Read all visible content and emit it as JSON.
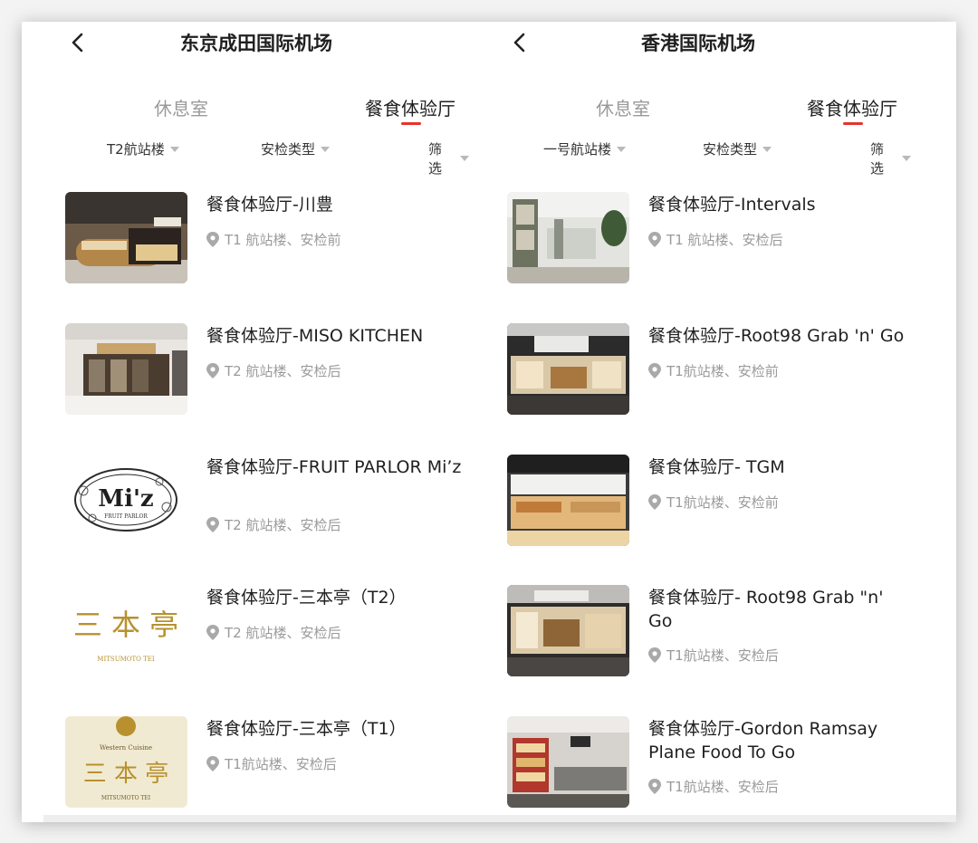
{
  "left": {
    "title": "东京成田国际机场",
    "tabs": [
      {
        "label": "休息室",
        "active": false
      },
      {
        "label": "餐食体验厅",
        "active": true
      }
    ],
    "filters": [
      {
        "label": "T2航站楼"
      },
      {
        "label": "安检类型"
      },
      {
        "label": "筛选"
      }
    ],
    "items": [
      {
        "title": "餐食体验厅-川豊",
        "location": "T1 航站楼、安检前",
        "thumb": "restaurant-counter-photo"
      },
      {
        "title": "餐食体验厅-MISO KITCHEN",
        "location": "T2 航站楼、安检后",
        "thumb": "restaurant-storefront-photo"
      },
      {
        "title": "餐食体验厅-FRUIT PARLOR Mi’z",
        "location": "T2 航站楼、安检后",
        "thumb": "miz-logo",
        "logo_text": "Mi'z",
        "logo_sub": "FRUIT PARLOR"
      },
      {
        "title": "餐食体验厅-三本亭（T2）",
        "location": "T2 航站楼、安检后",
        "thumb": "mitsumoto-logo",
        "logo_text": "三 本 亭",
        "logo_sub": "MITSUMOTO TEI"
      },
      {
        "title": "餐食体验厅-三本亭（T1）",
        "location": "T1航站楼、安检后",
        "thumb": "mitsumoto-logo-beige",
        "logo_text": "三 本 亭",
        "logo_top": "Western Cuisine",
        "logo_sub": "MITSUMOTO TEI"
      }
    ]
  },
  "right": {
    "title": "香港国际机场",
    "tabs": [
      {
        "label": "休息室",
        "active": false
      },
      {
        "label": "餐食体验厅",
        "active": true
      }
    ],
    "filters": [
      {
        "label": "一号航站楼"
      },
      {
        "label": "安检类型"
      },
      {
        "label": "筛选"
      }
    ],
    "items": [
      {
        "title": "餐食体验厅-Intervals",
        "location": "T1 航站楼、安检后",
        "thumb": "lounge-interior-photo"
      },
      {
        "title": "餐食体验厅-Root98 Grab 'n' Go",
        "location": "T1航站楼、安检前",
        "thumb": "root98-store-photo"
      },
      {
        "title": "餐食体验厅- TGM",
        "location": "T1航站楼、安检前",
        "thumb": "tgm-store-photo"
      },
      {
        "title": "餐食体验厅- Root98 Grab \"n' Go",
        "location": "T1航站楼、安检后",
        "thumb": "root98-store-photo-2"
      },
      {
        "title": "餐食体验厅-Gordon Ramsay Plane Food To Go",
        "location": "T1航站楼、安检后",
        "thumb": "gordon-ramsay-store-photo"
      }
    ]
  },
  "colors": {
    "accent_underline": "#e8322c",
    "text_primary": "#1f1f1f",
    "text_secondary": "#9a9a9a",
    "logo_gold": "#b8912e"
  }
}
